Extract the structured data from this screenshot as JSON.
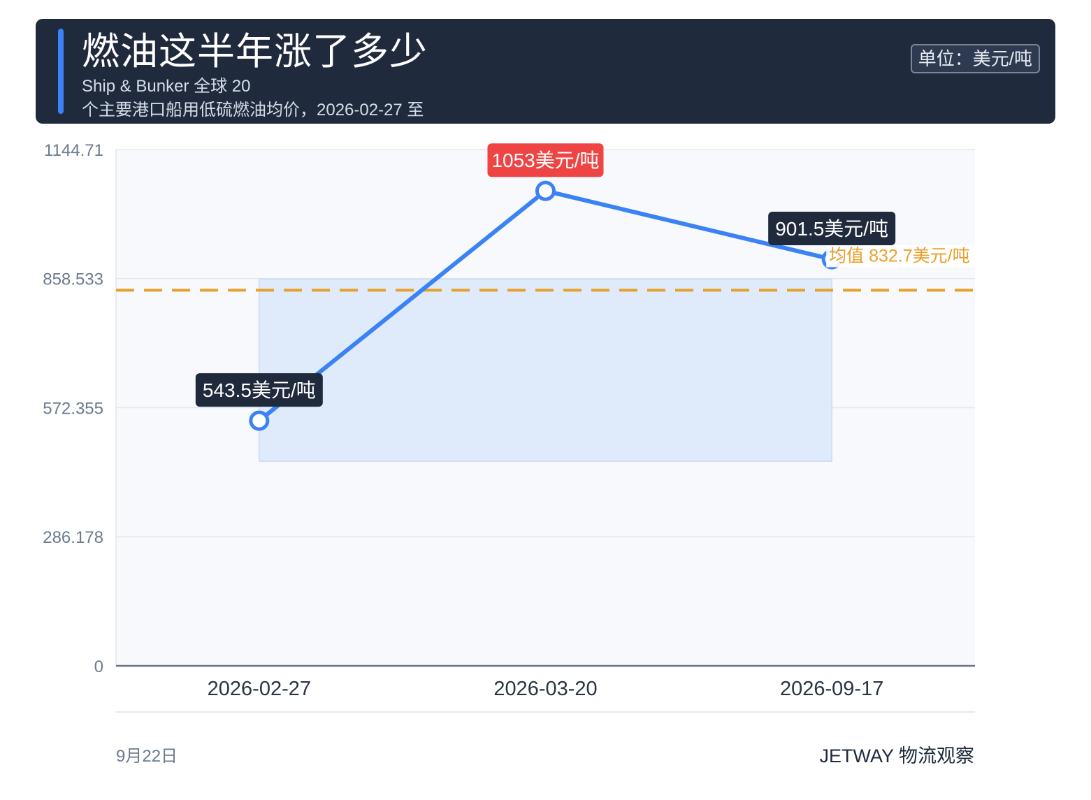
{
  "header": {
    "title": "燃油这半年涨了多少",
    "subtitle_line1": "Ship & Bunker 全球 20",
    "subtitle_line2": "个主要港口船用低硫燃油均价，2026-02-27 至",
    "unit": "单位：美元/吨"
  },
  "colors": {
    "header_bg": "#1f2a3c",
    "accent": "#3b82f6",
    "line": "#3b82f6",
    "area": "#dbe7fa",
    "average": "#e8a02a",
    "highlight": "#ef4444",
    "label_bg": "#1f2a3c"
  },
  "chart_data": {
    "type": "line",
    "x": [
      "2026-02-27",
      "2026-03-20",
      "2026-09-17"
    ],
    "series": [
      {
        "values": [
          543.5,
          1053,
          901.5
        ]
      }
    ],
    "point_labels": [
      "543.5美元/吨",
      "1053美元/吨",
      "901.5美元/吨"
    ],
    "highlight_index": 1,
    "yticks": [
      "0",
      "286.178",
      "572.355",
      "858.533",
      "1144.71"
    ],
    "ylim": [
      0,
      1144.71
    ],
    "average": {
      "value": 832.7,
      "label": "均值 832.7美元/吨"
    },
    "grid": true,
    "xlabel": "",
    "ylabel": ""
  },
  "footer": {
    "date": "9月22日",
    "brand": "JETWAY 物流观察"
  }
}
